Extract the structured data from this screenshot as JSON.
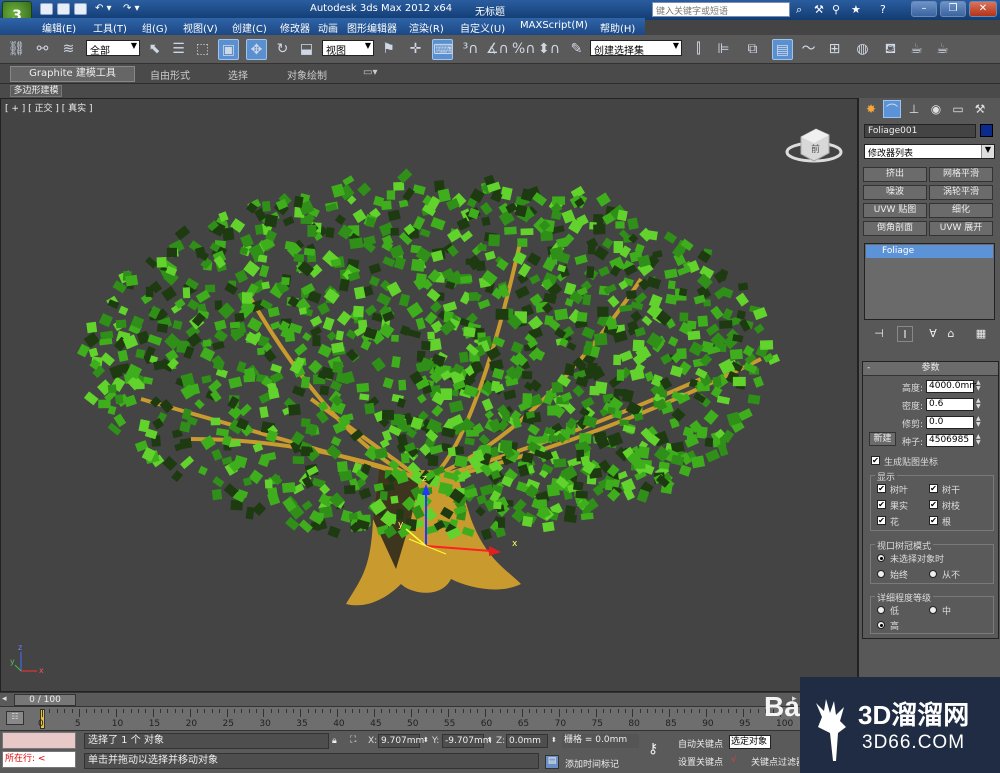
{
  "window": {
    "title": "Autodesk 3ds Max  2012 x64",
    "doc_title": "无标题",
    "search_placeholder": "键入关键字或短语"
  },
  "menu": [
    "编辑(E)",
    "工具(T)",
    "组(G)",
    "视图(V)",
    "创建(C)",
    "修改器",
    "动画",
    "图形编辑器",
    "渲染(R)",
    "自定义(U)",
    "MAXScript(M)",
    "帮助(H)"
  ],
  "toolbar": {
    "selection_filter": "全部",
    "ref_coord": "视图",
    "named_selection": "创建选择集"
  },
  "ribbon": {
    "tabs": [
      "Graphite 建模工具",
      "自由形式",
      "选择",
      "对象绘制"
    ],
    "sub_label": "多边形建模"
  },
  "viewport": {
    "label": "[ + ] [ 正交 ] [ 真实 ]",
    "cube_label": "前",
    "axes": [
      "x",
      "y",
      "z"
    ]
  },
  "panel": {
    "object_name": "Foliage001",
    "object_color": "#0b2a8c",
    "modifier_list": "修改器列表",
    "mod_buttons": [
      "挤出",
      "网格平滑",
      "噪波",
      "涡轮平滑",
      "UVW 贴图",
      "细化",
      "倒角剖面",
      "UVW 展开"
    ],
    "stack_item": "Foliage",
    "rollout_title": "参数",
    "params": {
      "height_label": "高度:",
      "height": "4000.0mm",
      "density_label": "密度:",
      "density": "0.6",
      "prune_label": "修剪:",
      "prune": "0.0",
      "new_label": "新建",
      "seed_label": "种子:",
      "seed": "4506985"
    },
    "gen_map": "生成贴图坐标",
    "display_group": "显示",
    "display_items": [
      "树叶",
      "树干",
      "果实",
      "树枝",
      "花",
      "根"
    ],
    "canopy_group": "视口树冠模式",
    "canopy_items": [
      "未选择对象时",
      "始终",
      "从不"
    ],
    "lod_group": "详细程度等级",
    "lod_items": [
      "低",
      "中",
      "高"
    ]
  },
  "timeline": {
    "slider": "0 / 100",
    "ticks": [
      "0",
      "5",
      "10",
      "15",
      "20",
      "25",
      "30",
      "35",
      "40",
      "45",
      "50",
      "55",
      "60",
      "65",
      "70",
      "75",
      "80",
      "85",
      "90",
      "95",
      "100"
    ]
  },
  "status": {
    "now_running": "所在行:",
    "line1": "选择了 1 个 对象",
    "line2": "单击并拖动以选择并移动对象",
    "x_label": "X:",
    "x": "9.707mm",
    "y_label": "Y:",
    "y": "-9.707mm",
    "z_label": "Z:",
    "z": "0.0mm",
    "grid": "栅格 = 0.0mm",
    "add_time_tag": "添加时间标记",
    "auto_key": "自动关键点",
    "set_key": "设置关键点",
    "selected": "选定对象",
    "key_filters": "关键点过滤器..."
  },
  "watermark": {
    "ba": "Ba",
    "line1": "3D溜溜网",
    "line2": "3D66.COM"
  },
  "colors": {
    "accent": "#5c93d8",
    "leaf": "#3fae1c",
    "trunk": "#c99a2e"
  }
}
